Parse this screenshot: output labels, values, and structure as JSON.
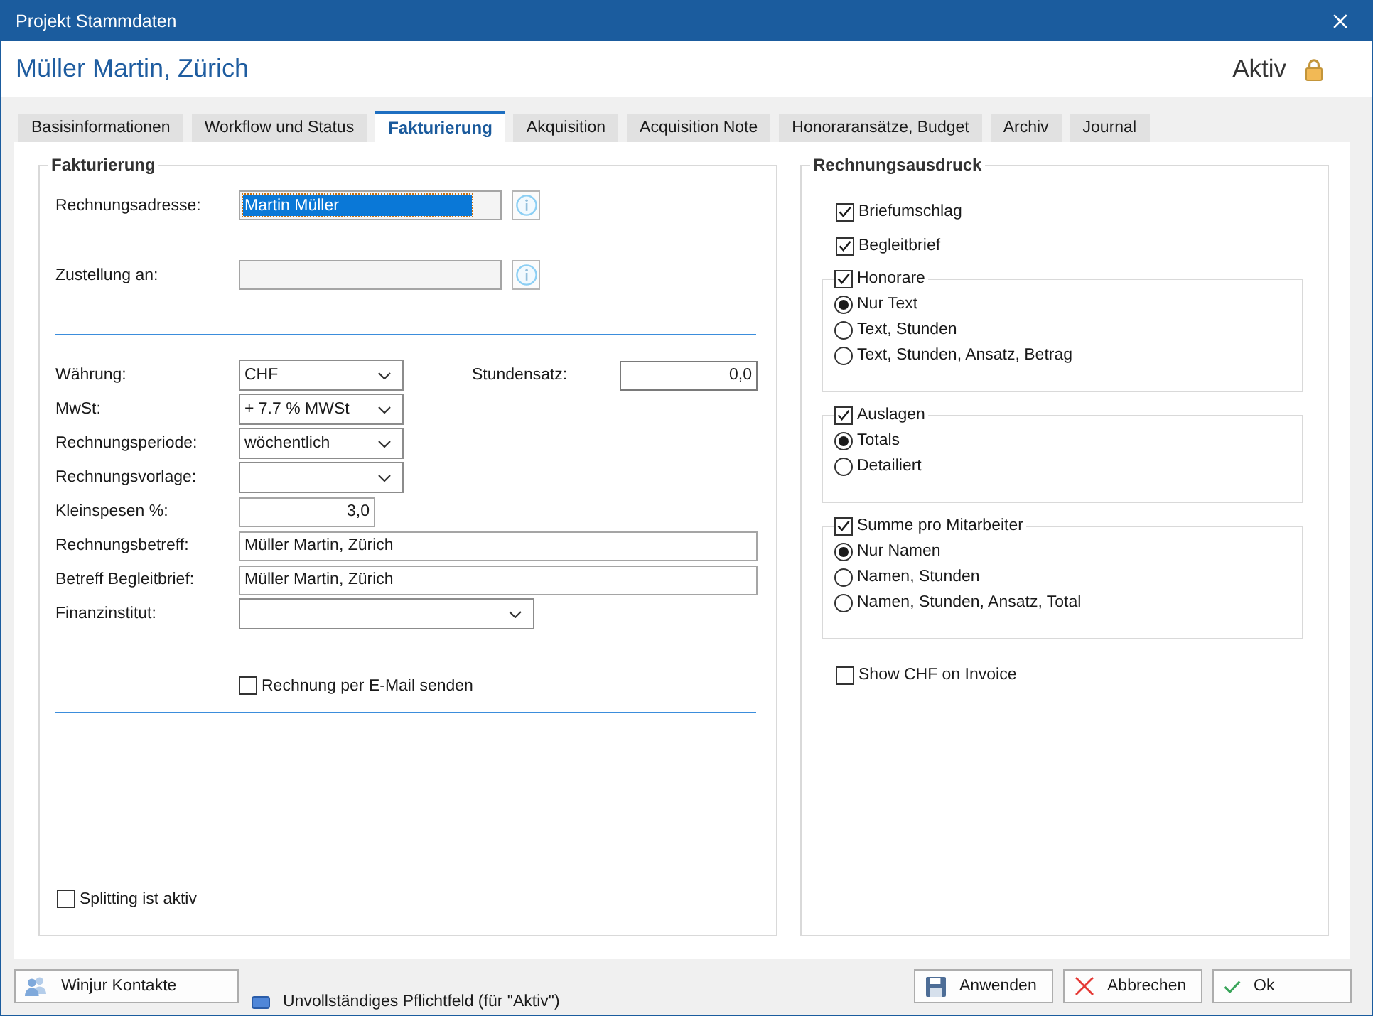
{
  "window": {
    "title": "Projekt Stammdaten"
  },
  "header": {
    "name": "Müller Martin, Zürich",
    "status": "Aktiv",
    "locked": true
  },
  "tabs": [
    {
      "label": "Basisinformationen",
      "selected": false
    },
    {
      "label": "Workflow und Status",
      "selected": false
    },
    {
      "label": "Fakturierung",
      "selected": true
    },
    {
      "label": "Akquisition",
      "selected": false
    },
    {
      "label": "Acquisition Note",
      "selected": false
    },
    {
      "label": "Honoraransätze, Budget",
      "selected": false
    },
    {
      "label": "Archiv",
      "selected": false
    },
    {
      "label": "Journal",
      "selected": false
    }
  ],
  "invoicing": {
    "title": "Fakturierung",
    "recipients": [
      {
        "label": "Rechnungsadresse:",
        "value": "Martin Müller",
        "text_selected": true
      },
      {
        "label": "Zustellung an:",
        "text_selected": false
      }
    ],
    "fields": [
      {
        "kind": "select",
        "label": "Währung:",
        "value": "CHF",
        "beside": {
          "kind": "number",
          "label": "Stundensatz:",
          "value": "0,0"
        }
      },
      {
        "kind": "select",
        "label": "MwSt:",
        "value": "+ 7.7 % MWSt"
      },
      {
        "kind": "select",
        "label": "Rechnungsperiode:",
        "value": "wöchentlich"
      },
      {
        "kind": "select",
        "label": "Rechnungsvorlage:"
      },
      {
        "kind": "number",
        "label": "Kleinspesen %:",
        "value": "3,0"
      },
      {
        "kind": "text",
        "label": "Rechnungsbetreff:",
        "value": "Müller Martin, Zürich"
      },
      {
        "kind": "text",
        "label": "Betreff Begleitbrief:",
        "value": "Müller Martin, Zürich"
      },
      {
        "kind": "select",
        "label": "Finanzinstitut:"
      }
    ],
    "send_by_email": {
      "label": "Rechnung per E-Mail senden",
      "checked": false
    },
    "splitting": {
      "label": "Splitting ist aktiv",
      "checked": false
    }
  },
  "invoice_print": {
    "title": "Rechnungsausdruck",
    "options": [
      {
        "label": "Briefumschlag",
        "checked": true
      },
      {
        "label": "Begleitbrief",
        "checked": true
      }
    ],
    "groups": [
      {
        "label": "Honorare",
        "checked": true,
        "choices": [
          {
            "label": "Nur Text",
            "selected": true
          },
          {
            "label": "Text, Stunden",
            "selected": false
          },
          {
            "label": "Text, Stunden, Ansatz, Betrag",
            "selected": false
          }
        ]
      },
      {
        "label": "Auslagen",
        "checked": true,
        "choices": [
          {
            "label": "Totals",
            "selected": true
          },
          {
            "label": "Detailiert",
            "selected": false
          }
        ]
      },
      {
        "label": "Summe pro Mitarbeiter",
        "checked": true,
        "choices": [
          {
            "label": "Nur Namen",
            "selected": true
          },
          {
            "label": "Namen, Stunden",
            "selected": false
          },
          {
            "label": "Namen, Stunden, Ansatz, Total",
            "selected": false
          }
        ]
      }
    ],
    "show_currency": {
      "label": "Show CHF on Invoice",
      "checked": false
    }
  },
  "footer": {
    "contacts_button": "Winjur Kontakte",
    "legend": "Unvollständiges Pflichtfeld (für \"Aktiv\")",
    "buttons": [
      {
        "kind": "apply",
        "label": "Anwenden"
      },
      {
        "kind": "cancel",
        "label": "Abbrechen"
      },
      {
        "kind": "ok",
        "label": "Ok"
      }
    ]
  }
}
